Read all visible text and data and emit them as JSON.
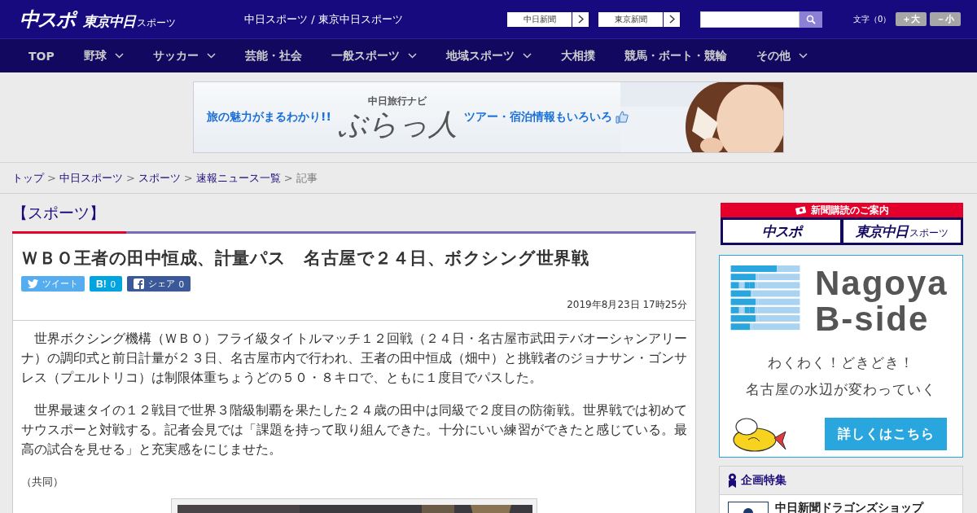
{
  "header": {
    "logo_main": "中スポ",
    "logo_sub": "東京中日",
    "logo_sub_small": "スポーツ",
    "site_title": "中日スポーツ / 東京中日スポーツ",
    "links": [
      {
        "label": "中日新聞"
      },
      {
        "label": "東京新聞"
      }
    ],
    "font_size": {
      "label": "文字（0）",
      "buttons": [
        "＋大",
        "－小"
      ]
    }
  },
  "nav": [
    {
      "label": "TOP",
      "kind": "link"
    },
    {
      "label": "野球",
      "kind": "menu"
    },
    {
      "label": "サッカー",
      "kind": "menu"
    },
    {
      "label": "芸能・社会",
      "kind": "link"
    },
    {
      "label": "一般スポーツ",
      "kind": "menu"
    },
    {
      "label": "地域スポーツ",
      "kind": "menu"
    },
    {
      "label": "大相撲",
      "kind": "link"
    },
    {
      "label": "競馬・ボート・競輪",
      "kind": "link"
    },
    {
      "label": "その他",
      "kind": "menu"
    }
  ],
  "banner": {
    "left": "旅の魅力がまるわかり!!",
    "brand_small": "中日旅行ナビ",
    "brand": "ぶらっ人",
    "right": "ツアー・宿泊情報もいろいろ"
  },
  "breadcrumb": [
    {
      "label": "トップ",
      "kind": "link"
    },
    {
      "separator": ">",
      "label": "中日スポーツ",
      "kind": "link"
    },
    {
      "separator": ">",
      "label": "スポーツ",
      "kind": "link"
    },
    {
      "separator": ">",
      "label": "速報ニュース一覧",
      "kind": "link"
    },
    {
      "separator": ">",
      "label": "記事",
      "kind": "current"
    }
  ],
  "category": "【スポーツ】",
  "article": {
    "title": "ＷＢＯ王者の田中恒成、計量パス　名古屋で２４日、ボクシング世界戦",
    "share": [
      {
        "kind": "twitter",
        "label": "ツイート"
      },
      {
        "kind": "hatena",
        "label": "B!",
        "count": "0"
      },
      {
        "kind": "facebook",
        "label": "シェア",
        "count": "0"
      }
    ],
    "date": "2019年8月23日 17時25分",
    "paragraphs": [
      "世界ボクシング機構（ＷＢＯ）フライ級タイトルマッチ１２回戦（２４日・名古屋市武田テバオーシャンアリーナ）の調印式と前日計量が２３日、名古屋市内で行われ、王者の田中恒成（畑中）と挑戦者のジョナサン・ゴンサレス（プエルトリコ）は制限体重ちょうどの５０・８キロで、ともに１度目でパスした。",
      "世界最速タイの１２戦目で世界３階級制覇を果たした２４歳の田中は同級で２度目の防衛戦。世界戦では初めてサウスポーと対戦する。記者会見では「課題を持って取り組んできた。十分にいい練習ができたと感じている。最高の試合を見せる」と充実感をにじませた。"
    ],
    "credit": "（共同）",
    "photo": {
      "kind": "picture"
    }
  },
  "sidebar": {
    "subscribe": {
      "title": "新聞購読のご案内",
      "logos": [
        "中スポ",
        "東京中日"
      ],
      "logo_small": "スポーツ"
    },
    "ad": {
      "title_lines": [
        "Nagoya",
        "B-side"
      ],
      "lines": [
        "わくわく！どきどき！",
        "名古屋の水辺が変わっていく"
      ],
      "button": "詳しくはこちら"
    },
    "features": {
      "title": "企画特集",
      "items": [
        {
          "label": "中日新聞ドラゴンズショップ"
        }
      ]
    }
  }
}
